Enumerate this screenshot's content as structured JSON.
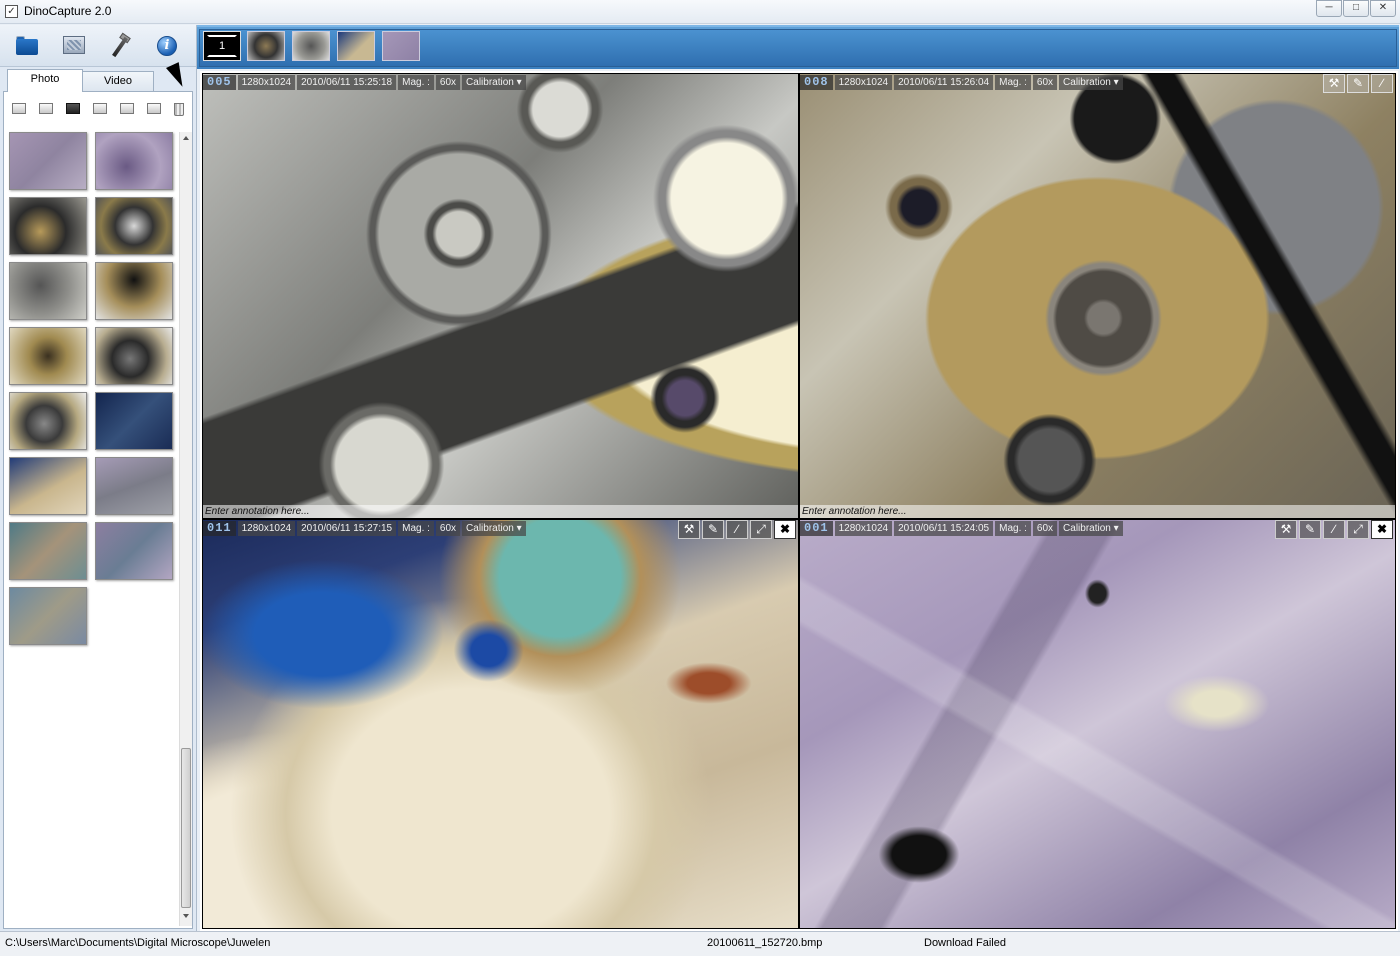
{
  "window": {
    "title": "DinoCapture 2.0"
  },
  "left_panel": {
    "tabs": [
      {
        "label": "Photo",
        "active": true
      },
      {
        "label": "Video",
        "active": false
      }
    ],
    "top_icons": [
      "folder-icon",
      "screen-capture-icon",
      "tools-icon",
      "info-icon"
    ],
    "toolbar_icons": [
      "open-icon",
      "copy-icon",
      "save-icon",
      "rename-icon",
      "print-icon",
      "email-icon",
      "trash-icon"
    ],
    "thumbnail_count": 15
  },
  "capture_strip": {
    "live_label": "1",
    "thumbnail_count": 4
  },
  "viewer": {
    "panels": [
      {
        "index": "005",
        "resolution": "1280x1024",
        "datetime": "2010/06/11 15:25:18",
        "mag_label": "Mag. :",
        "mag_value": "60x",
        "calibration": "Calibration",
        "annotation": "Enter annotation here..."
      },
      {
        "index": "008",
        "resolution": "1280x1024",
        "datetime": "2010/06/11 15:26:04",
        "mag_label": "Mag. :",
        "mag_value": "60x",
        "calibration": "Calibration",
        "annotation": "Enter annotation here..."
      },
      {
        "index": "011",
        "resolution": "1280x1024",
        "datetime": "2010/06/11 15:27:15",
        "mag_label": "Mag. :",
        "mag_value": "60x",
        "calibration": "Calibration"
      },
      {
        "index": "001",
        "resolution": "1280x1024",
        "datetime": "2010/06/11 15:24:05",
        "mag_label": "Mag. :",
        "mag_value": "60x",
        "calibration": "Calibration"
      }
    ],
    "panel_controls": [
      "wrench-icon",
      "pen-icon",
      "ruler-icon",
      "fullscreen-icon",
      "close-icon"
    ]
  },
  "status_bar": {
    "path": "C:\\Users\\Marc\\Documents\\Digital Microscope\\Juwelen",
    "filename": "20100611_152720.bmp",
    "status": "Download Failed"
  }
}
